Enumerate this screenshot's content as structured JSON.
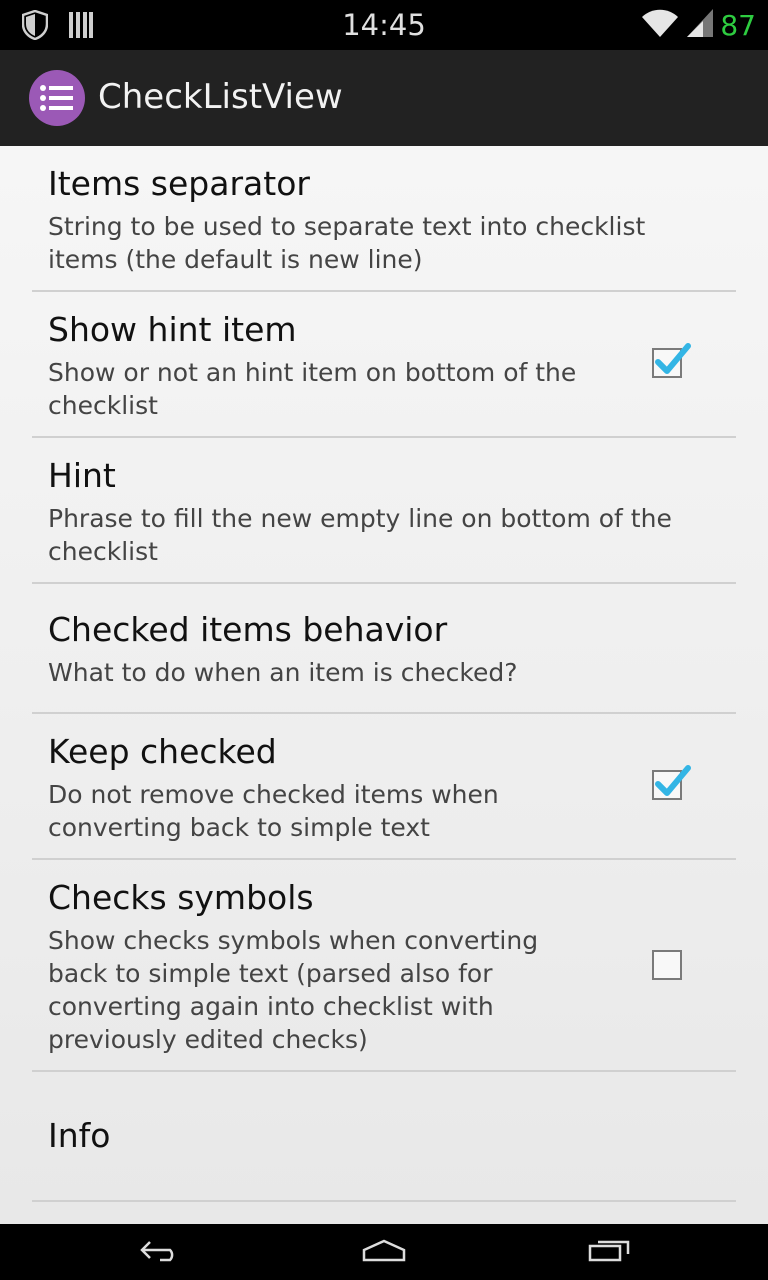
{
  "status_bar": {
    "time": "14:45",
    "battery": "87",
    "icons": [
      "shield-icon",
      "barcode-icon",
      "wifi-icon",
      "signal-icon"
    ]
  },
  "action_bar": {
    "title": "CheckListView",
    "app_icon": "list-icon",
    "accent": "#9b59b6"
  },
  "preferences": [
    {
      "title": "Items separator",
      "summary": "String to be used to separate text into checklist items (the default is new line)"
    },
    {
      "title": "Show hint item",
      "summary": "Show or not an hint item on bottom of the checklist",
      "checked": true
    },
    {
      "title": "Hint",
      "summary": "Phrase to fill the new empty line on bottom of the checklist"
    },
    {
      "title": "Checked items behavior",
      "summary": "What to do when an item is checked?"
    },
    {
      "title": "Keep checked",
      "summary": "Do not remove checked items when converting back to simple text",
      "checked": true
    },
    {
      "title": "Checks symbols",
      "summary": "Show checks symbols when converting back to simple text (parsed also for converting again into checklist with previously edited checks)",
      "checked": false
    },
    {
      "title": "Info"
    }
  ],
  "nav_bar": {
    "icons": [
      "back-icon",
      "home-icon",
      "recents-icon"
    ]
  },
  "colors": {
    "check_accent": "#33b5e5",
    "battery": "#2ecc40"
  }
}
